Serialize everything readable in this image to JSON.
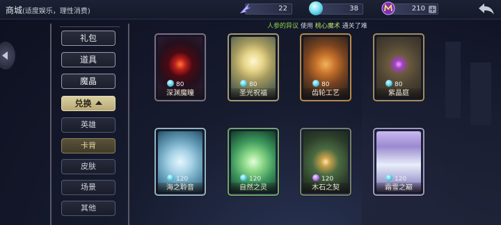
{
  "header": {
    "title": "商城",
    "subtitle": "(适度娱乐，理性消费)"
  },
  "currencies": [
    {
      "name": "feather",
      "icon": "feather-icon",
      "value": "22",
      "color": "#b4a8ff"
    },
    {
      "name": "gem",
      "icon": "gem-icon",
      "value": "38",
      "color": "#5fd4ea"
    },
    {
      "name": "magic",
      "icon": "magic-m-icon",
      "value": "210",
      "color": "#b25ae6"
    }
  ],
  "notice": {
    "prefix": "人参的异议",
    "middle": " 使用 ",
    "item": "桃心魔术",
    "suffix": " 通关了难"
  },
  "menu": {
    "main": [
      {
        "label": "礼包"
      },
      {
        "label": "道具"
      },
      {
        "label": "魔晶"
      }
    ],
    "group": {
      "label": "兑换"
    },
    "sub": [
      {
        "label": "英雄",
        "selected": false
      },
      {
        "label": "卡背",
        "selected": true
      },
      {
        "label": "皮肤",
        "selected": false
      },
      {
        "label": "场景",
        "selected": false
      },
      {
        "label": "其他",
        "selected": false
      }
    ]
  },
  "cards": [
    {
      "name": "深渊魔瞳",
      "price": "80",
      "currency": "gem"
    },
    {
      "name": "圣光祝福",
      "price": "80",
      "currency": "gem"
    },
    {
      "name": "齿轮工艺",
      "price": "80",
      "currency": "gem"
    },
    {
      "name": "紫晶庭",
      "price": "80",
      "currency": "gem"
    },
    {
      "name": "海之聆音",
      "price": "120",
      "currency": "gem"
    },
    {
      "name": "自然之灵",
      "price": "120",
      "currency": "gem"
    },
    {
      "name": "木石之契",
      "price": "120",
      "currency": "feather"
    },
    {
      "name": "霜雪之巅",
      "price": "120",
      "currency": "gem"
    }
  ]
}
